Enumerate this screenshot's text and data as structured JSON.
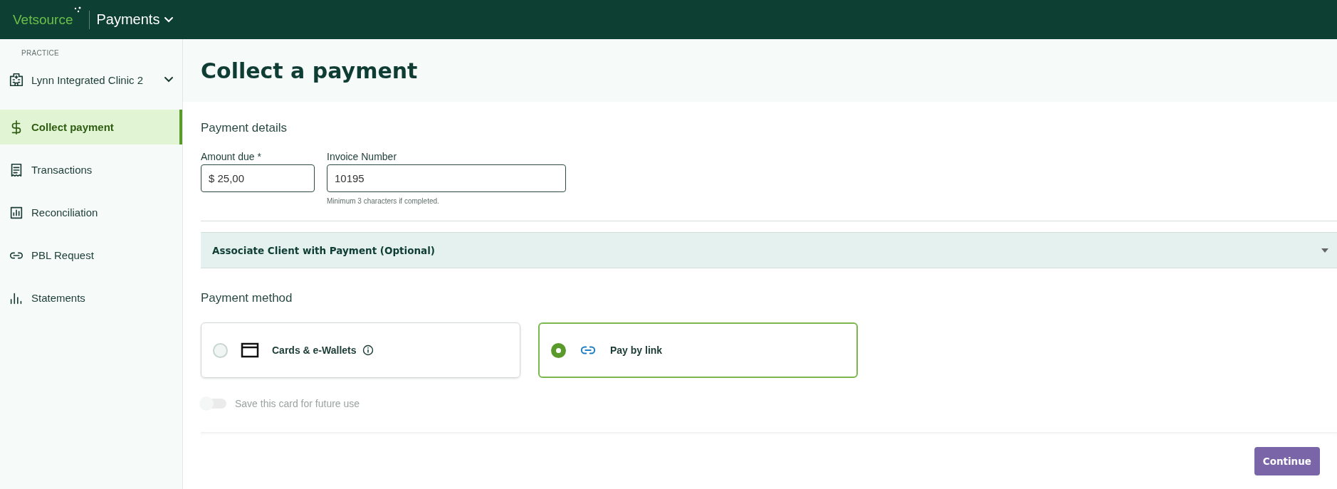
{
  "header": {
    "brand": "Vetsource",
    "app": "Payments"
  },
  "sidebar": {
    "section_label": "PRACTICE",
    "practice": "Lynn Integrated Clinic 2",
    "items": [
      {
        "label": "Collect payment",
        "selected": true
      },
      {
        "label": "Transactions",
        "selected": false
      },
      {
        "label": "Reconciliation",
        "selected": false
      },
      {
        "label": "PBL Request",
        "selected": false
      },
      {
        "label": "Statements",
        "selected": false
      }
    ]
  },
  "page": {
    "title": "Collect a payment"
  },
  "payment_details": {
    "heading": "Payment details",
    "fields": [
      {
        "label": "Amount due *",
        "value": "$ 25,00"
      },
      {
        "label": "Invoice Number",
        "value": "10195",
        "hint": "Minimum 3 characters if completed."
      }
    ]
  },
  "accordion": {
    "title": "Associate Client with Payment (Optional)",
    "expanded": false
  },
  "payment_method": {
    "heading": "Payment method",
    "options": [
      {
        "label": "Cards & e-Wallets",
        "selected": false
      },
      {
        "label": "Pay by link",
        "selected": true
      }
    ]
  },
  "save_card": {
    "label": "Save this card for future use",
    "on": false
  },
  "footer": {
    "button": "Continue"
  }
}
